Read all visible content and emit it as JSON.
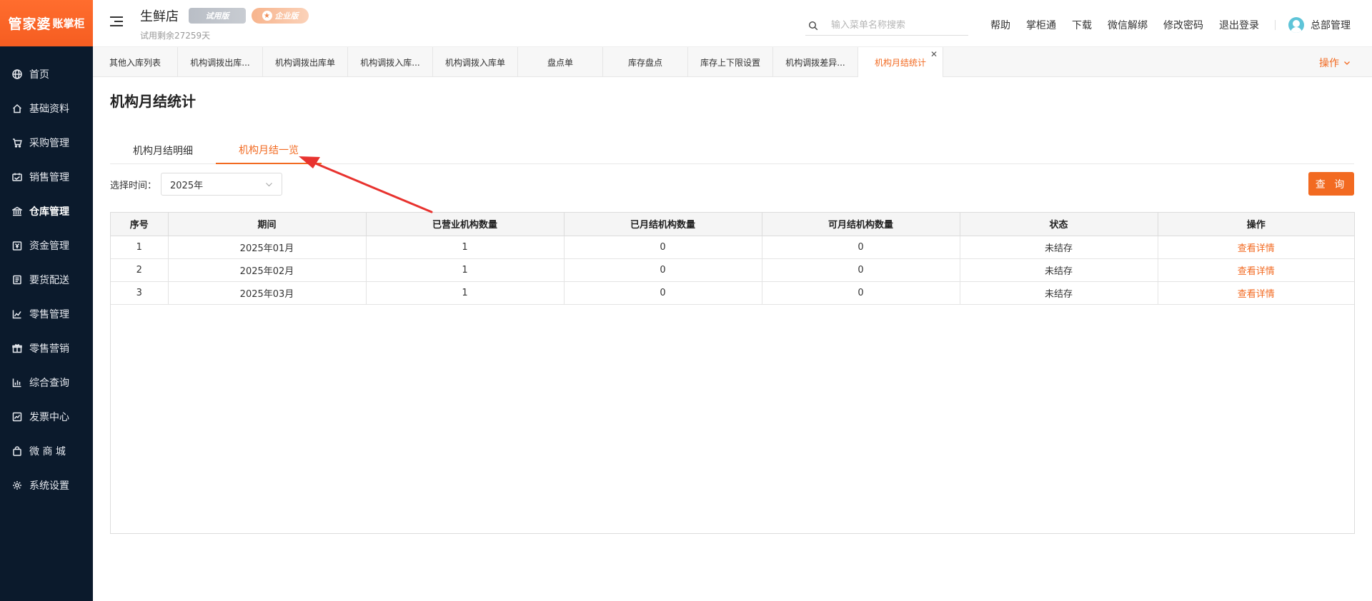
{
  "brand": {
    "logo_main": "管家婆",
    "logo_sub": "账掌柜"
  },
  "sidebar": {
    "items": [
      {
        "label": "首页",
        "icon": "globe-icon"
      },
      {
        "label": "基础资料",
        "icon": "home-icon"
      },
      {
        "label": "采购管理",
        "icon": "cart-icon"
      },
      {
        "label": "销售管理",
        "icon": "sales-icon"
      },
      {
        "label": "仓库管理",
        "icon": "bank-icon"
      },
      {
        "label": "资金管理",
        "icon": "money-icon"
      },
      {
        "label": "要货配送",
        "icon": "document-icon"
      },
      {
        "label": "零售管理",
        "icon": "chart-icon"
      },
      {
        "label": "零售营销",
        "icon": "gift-icon"
      },
      {
        "label": "综合查询",
        "icon": "bar-chart-icon"
      },
      {
        "label": "发票中心",
        "icon": "trend-icon"
      },
      {
        "label": "微 商 城",
        "icon": "bag-icon"
      },
      {
        "label": "系统设置",
        "icon": "gear-icon"
      }
    ],
    "active_index": 4
  },
  "header": {
    "store_name": "生鲜店",
    "trial_badge": "试用版",
    "pro_badge": "企业版",
    "trial_remaining": "试用剩余27259天",
    "search_placeholder": "输入菜单名称搜索",
    "links": [
      "帮助",
      "掌柜通",
      "下载",
      "微信解绑",
      "修改密码",
      "退出登录"
    ],
    "user": "总部管理"
  },
  "tabs": {
    "items": [
      "其他入库列表",
      "机构调拨出库...",
      "机构调拨出库单",
      "机构调拨入库...",
      "机构调拨入库单",
      "盘点单",
      "库存盘点",
      "库存上下限设置",
      "机构调拨差异...",
      "机构月结统计"
    ],
    "active_index": 9,
    "ops_label": "操作"
  },
  "page": {
    "title": "机构月结统计",
    "subtabs": [
      "机构月结明细",
      "机构月结一览"
    ],
    "active_subtab": 1,
    "filter_label": "选择时间：",
    "filter_value": "2025年",
    "query_button": "查 询"
  },
  "table": {
    "columns": [
      "序号",
      "期间",
      "已营业机构数量",
      "已月结机构数量",
      "可月结机构数量",
      "状态",
      "操作"
    ],
    "rows": [
      {
        "no": "1",
        "period": "2025年01月",
        "open": "1",
        "closed": "0",
        "closable": "0",
        "status": "未结存",
        "action": "查看详情"
      },
      {
        "no": "2",
        "period": "2025年02月",
        "open": "1",
        "closed": "0",
        "closable": "0",
        "status": "未结存",
        "action": "查看详情"
      },
      {
        "no": "3",
        "period": "2025年03月",
        "open": "1",
        "closed": "0",
        "closable": "0",
        "status": "未结存",
        "action": "查看详情"
      }
    ]
  },
  "colors": {
    "accent": "#f26a21",
    "sidebar_bg": "#0b1a2c",
    "annotation_arrow": "#e8332f"
  }
}
